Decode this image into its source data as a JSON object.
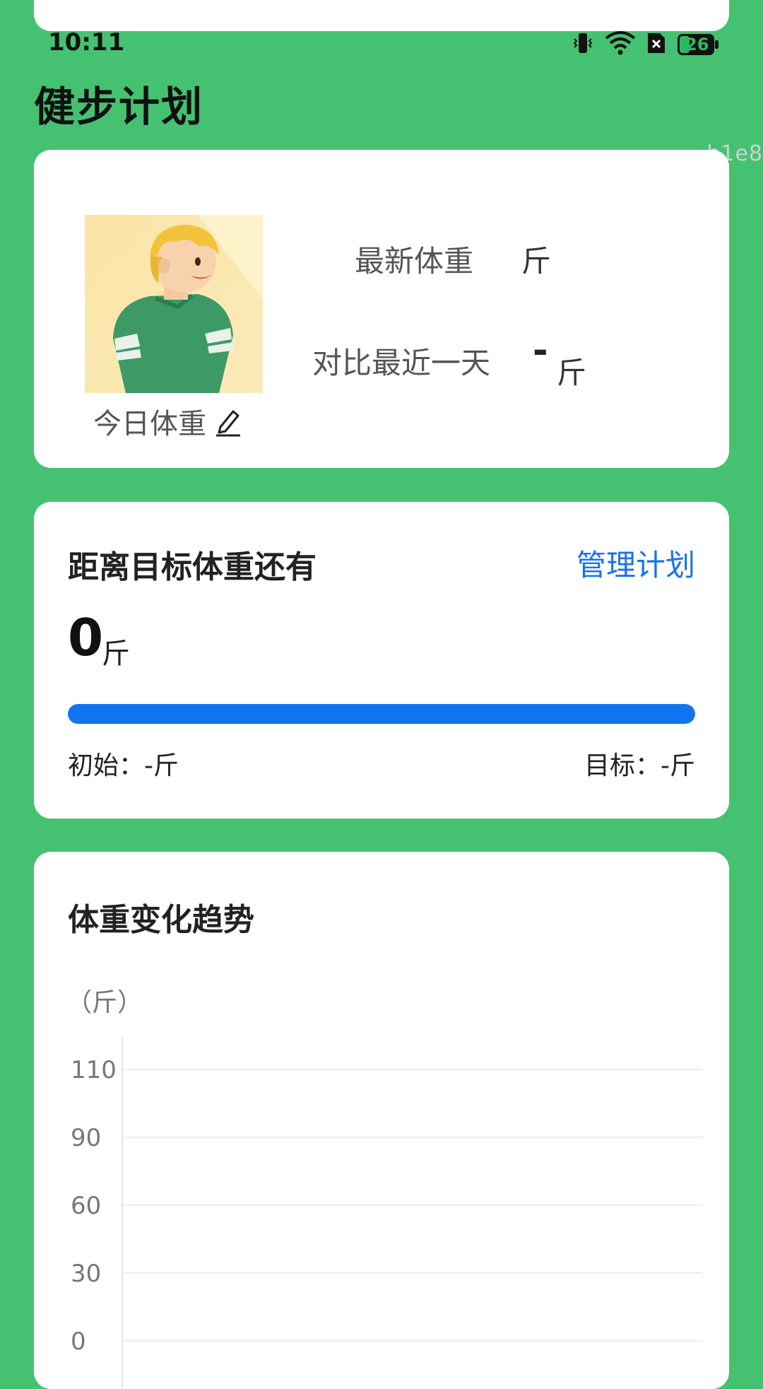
{
  "status_bar": {
    "time": "10:11",
    "battery": "26"
  },
  "app": {
    "title": "健步计划"
  },
  "watermark": "b1e8",
  "profile": {
    "today_weight_label": "今日体重",
    "latest_weight_label": "最新体重",
    "latest_weight_unit": "斤",
    "compare_label": "对比最近一天",
    "compare_value": "-",
    "compare_unit": "斤"
  },
  "goal": {
    "title": "距离目标体重还有",
    "manage_label": "管理计划",
    "remaining_value": "0",
    "remaining_unit": "斤",
    "progress": 1,
    "start_label": "初始：-斤",
    "target_label": "目标：-斤"
  },
  "trend": {
    "title": "体重变化趋势",
    "unit_label": "（斤）"
  },
  "chart_data": {
    "type": "line",
    "title": "体重变化趋势",
    "ylabel": "（斤）",
    "yticks": [
      "110",
      "90",
      "60",
      "30",
      "0"
    ],
    "ylim": [
      0,
      110
    ],
    "grid": true,
    "series": []
  },
  "colors": {
    "background": "#45c271",
    "accent": "#1a73e8",
    "progress": "#1174f1"
  }
}
